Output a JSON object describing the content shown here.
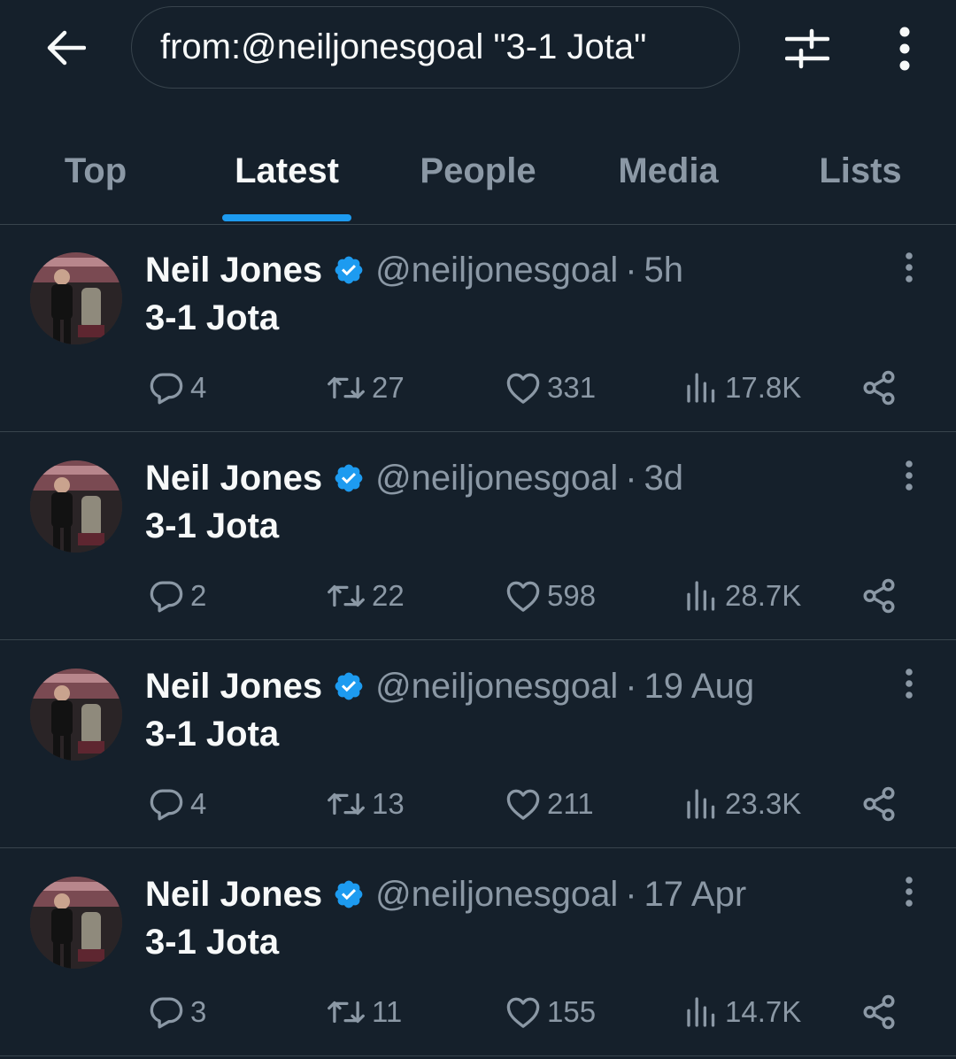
{
  "search": {
    "query": "from:@neiljonesgoal \"3-1 Jota\""
  },
  "tabs": [
    {
      "label": "Top",
      "active": false
    },
    {
      "label": "Latest",
      "active": true
    },
    {
      "label": "People",
      "active": false
    },
    {
      "label": "Media",
      "active": false
    },
    {
      "label": "Lists",
      "active": false
    }
  ],
  "colors": {
    "background": "#15202b",
    "accent": "#1d9bf0",
    "muted": "#8b98a5",
    "divider": "#38444d"
  },
  "icons": {
    "header": [
      "back-arrow-icon",
      "filter-sliders-icon",
      "more-vertical-icon"
    ],
    "tweet": [
      "verified-badge-icon",
      "more-vertical-icon",
      "reply-icon",
      "retweet-icon",
      "like-icon",
      "views-icon",
      "share-icon"
    ]
  },
  "tweets": [
    {
      "name": "Neil Jones",
      "handle": "@neiljonesgoal",
      "sep": "·",
      "time": "5h",
      "text": "3-1 Jota",
      "replies": "4",
      "retweets": "27",
      "likes": "331",
      "views": "17.8K"
    },
    {
      "name": "Neil Jones",
      "handle": "@neiljonesgoal",
      "sep": "·",
      "time": "3d",
      "text": "3-1 Jota",
      "replies": "2",
      "retweets": "22",
      "likes": "598",
      "views": "28.7K"
    },
    {
      "name": "Neil Jones",
      "handle": "@neiljonesgoal",
      "sep": "·",
      "time": "19 Aug",
      "text": "3-1 Jota",
      "replies": "4",
      "retweets": "13",
      "likes": "211",
      "views": "23.3K"
    },
    {
      "name": "Neil Jones",
      "handle": "@neiljonesgoal",
      "sep": "·",
      "time": "17 Apr",
      "text": "3-1 Jota",
      "replies": "3",
      "retweets": "11",
      "likes": "155",
      "views": "14.7K"
    }
  ]
}
